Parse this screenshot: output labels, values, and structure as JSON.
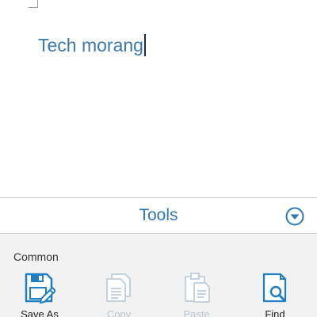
{
  "document": {
    "text": "Tech morang"
  },
  "tools_bar": {
    "title": "Tools"
  },
  "tools_panel": {
    "section_label": "Common",
    "items": [
      {
        "label": "Save As",
        "icon": "save-as-icon",
        "enabled": true
      },
      {
        "label": "Copy",
        "icon": "copy-icon",
        "enabled": false
      },
      {
        "label": "Paste",
        "icon": "paste-icon",
        "enabled": false
      },
      {
        "label": "Find",
        "icon": "find-icon",
        "enabled": true
      }
    ]
  },
  "colors": {
    "accent": "#2e7ab8",
    "doc_text": "#3b78ad",
    "panel_bg": "#f2f2f2",
    "disabled": "#b8c4cf"
  }
}
